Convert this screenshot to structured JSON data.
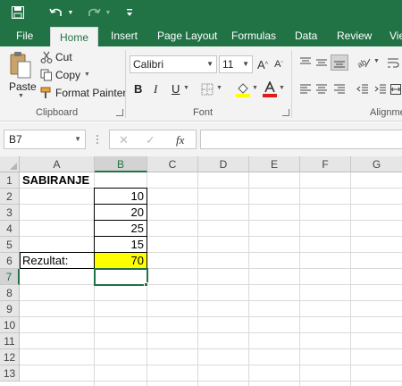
{
  "quick_access": {
    "save_icon": "save-icon",
    "undo_icon": "undo-icon",
    "redo_icon": "redo-icon",
    "customize_icon": "customize-icon"
  },
  "tabs": [
    {
      "label": "File"
    },
    {
      "label": "Home"
    },
    {
      "label": "Insert"
    },
    {
      "label": "Page Layout"
    },
    {
      "label": "Formulas"
    },
    {
      "label": "Data"
    },
    {
      "label": "Review"
    },
    {
      "label": "Vie"
    }
  ],
  "active_tab": "Home",
  "ribbon": {
    "clipboard": {
      "paste": "Paste",
      "cut": "Cut",
      "copy": "Copy",
      "format_painter": "Format Painter",
      "group": "Clipboard"
    },
    "font": {
      "name": "Calibri",
      "size": "11",
      "bold": "B",
      "italic": "I",
      "underline": "U",
      "group": "Font"
    },
    "alignment": {
      "group": "Alignme"
    }
  },
  "formula_bar": {
    "name_box": "B7",
    "cancel": "✕",
    "enter": "✓",
    "fx": "fx",
    "value": ""
  },
  "sheet": {
    "columns": [
      "A",
      "B",
      "C",
      "D",
      "E",
      "F",
      "G"
    ],
    "rows": [
      "1",
      "2",
      "3",
      "4",
      "5",
      "6",
      "7",
      "8",
      "9",
      "10",
      "11",
      "12",
      "13"
    ],
    "cells": {
      "A1": "SABIRANJE",
      "B2": "10",
      "B3": "20",
      "B4": "25",
      "B5": "15",
      "A6": "Rezultat:",
      "B6": "70"
    },
    "highlight_color": "#ffff00",
    "accent_color": "#217346"
  }
}
